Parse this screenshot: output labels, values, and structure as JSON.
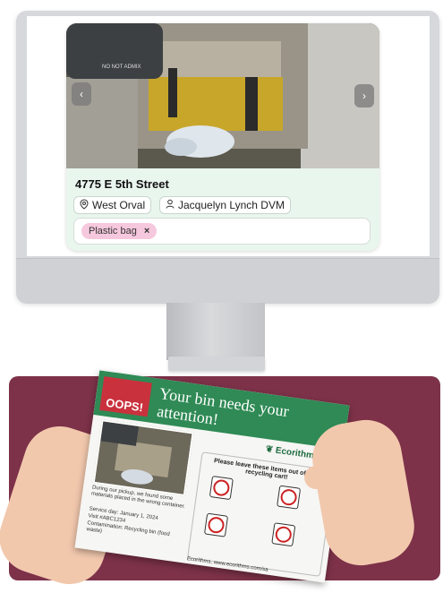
{
  "listing": {
    "address": "4775 E 5th Street",
    "location_chip": "West Orval",
    "person_chip": "Jacquelyn Lynch DVM",
    "tag": "Plastic bag",
    "tag_remove": "×",
    "prev": "‹",
    "next": "›",
    "bin_label": "NO NOT ADMIX"
  },
  "postcard": {
    "badge": "OOPS!",
    "title": "Your bin needs your attention!",
    "brand": "Ecorithms",
    "message": "During our pickup, we found some materials placed in the wrong container.",
    "service_day": "Service day: January 1, 2024",
    "visit": "Visit #ABC1234",
    "contamination": "Contamination: Recycling bin (food waste)",
    "leave_title": "Please leave these items out of your recycling cart!",
    "footer": "Ecorithms, www.ecorithms.com/sa"
  },
  "colors": {
    "card_bg": "#e9f6ee",
    "tag_bg": "#f6c8de",
    "postcard_header": "#2f8a55",
    "postcard_bg": "#7d3249",
    "oops": "#c9313d"
  }
}
